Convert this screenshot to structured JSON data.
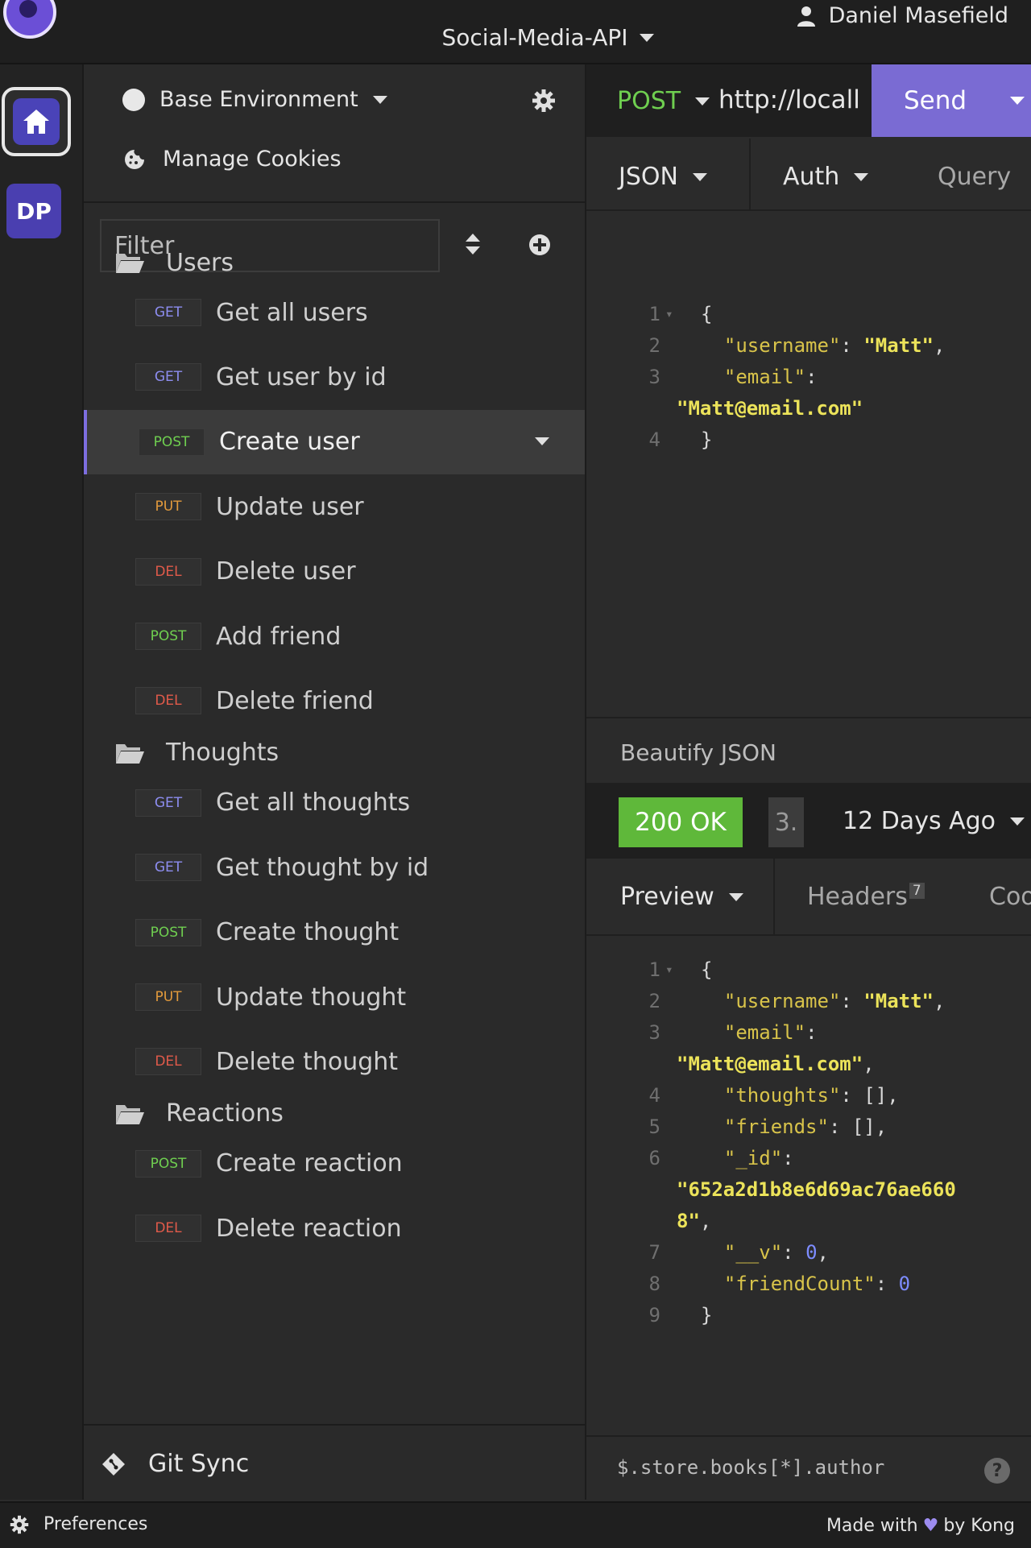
{
  "colors": {
    "accent": "#7a6bd3",
    "get": "#8d8df0",
    "post": "#6fcf50",
    "put": "#e29a3c",
    "del": "#e05a4a",
    "status_ok": "#5fb83a"
  },
  "topbar": {
    "project": "Social-Media-API",
    "user": "Daniel Masefield"
  },
  "rail": {
    "workspace_initials": "DP"
  },
  "sidebar": {
    "environment": "Base Environment",
    "manage_cookies": "Manage Cookies",
    "filter_placeholder": "Filter",
    "folders": [
      {
        "name": "Users",
        "requests": [
          {
            "method": "GET",
            "name": "Get all users"
          },
          {
            "method": "GET",
            "name": "Get user by id"
          },
          {
            "method": "POST",
            "name": "Create user"
          },
          {
            "method": "PUT",
            "name": "Update user"
          },
          {
            "method": "DEL",
            "name": "Delete user"
          },
          {
            "method": "POST",
            "name": "Add friend"
          },
          {
            "method": "DEL",
            "name": "Delete friend"
          }
        ]
      },
      {
        "name": "Thoughts",
        "requests": [
          {
            "method": "GET",
            "name": "Get all thoughts"
          },
          {
            "method": "GET",
            "name": "Get thought by id"
          },
          {
            "method": "POST",
            "name": "Create thought"
          },
          {
            "method": "PUT",
            "name": "Update thought"
          },
          {
            "method": "DEL",
            "name": "Delete thought"
          }
        ]
      },
      {
        "name": "Reactions",
        "requests": [
          {
            "method": "POST",
            "name": "Create reaction"
          },
          {
            "method": "DEL",
            "name": "Delete reaction"
          }
        ]
      }
    ],
    "git_sync": "Git Sync"
  },
  "request": {
    "method": "POST",
    "url": "http://locall",
    "send_label": "Send",
    "tabs": {
      "body": "JSON",
      "auth": "Auth",
      "query": "Query"
    },
    "beautify": "Beautify JSON"
  },
  "response": {
    "status": "200 OK",
    "time": "3.",
    "history": "12 Days Ago",
    "tabs": {
      "preview": "Preview",
      "headers": "Headers",
      "headers_count": "7",
      "cookies": "Coo"
    },
    "jsonpath_placeholder": "$.store.books[*].author",
    "help": "?"
  },
  "footer": {
    "preferences": "Preferences",
    "made_with": "Made with",
    "by": "by Kong"
  },
  "editors": {
    "request_body": [
      {
        "n": "1",
        "fold": true,
        "parts": [
          [
            "p",
            "{"
          ]
        ]
      },
      {
        "n": "2",
        "parts": [
          [
            "p",
            "  "
          ],
          [
            "k",
            "\"username\""
          ],
          [
            "p",
            ": "
          ],
          [
            "s",
            "\"Matt\""
          ],
          [
            "p",
            ","
          ]
        ]
      },
      {
        "n": "3",
        "parts": [
          [
            "p",
            "  "
          ],
          [
            "k",
            "\"email\""
          ],
          [
            "p",
            ":"
          ]
        ]
      },
      {
        "n": "",
        "parts": [
          [
            "s",
            "\"Matt@email.com\""
          ]
        ],
        "wrap": true
      },
      {
        "n": "4",
        "parts": [
          [
            "p",
            "}"
          ]
        ]
      }
    ],
    "response_body": [
      {
        "n": "1",
        "fold": true,
        "parts": [
          [
            "p",
            "{"
          ]
        ]
      },
      {
        "n": "2",
        "parts": [
          [
            "p",
            "  "
          ],
          [
            "k",
            "\"username\""
          ],
          [
            "p",
            ": "
          ],
          [
            "s",
            "\"Matt\""
          ],
          [
            "p",
            ","
          ]
        ]
      },
      {
        "n": "3",
        "parts": [
          [
            "p",
            "  "
          ],
          [
            "k",
            "\"email\""
          ],
          [
            "p",
            ":"
          ]
        ]
      },
      {
        "n": "",
        "parts": [
          [
            "s",
            "\"Matt@email.com\""
          ],
          [
            "p",
            ","
          ]
        ],
        "wrap": true
      },
      {
        "n": "4",
        "parts": [
          [
            "p",
            "  "
          ],
          [
            "k",
            "\"thoughts\""
          ],
          [
            "p",
            ": [],"
          ]
        ]
      },
      {
        "n": "5",
        "parts": [
          [
            "p",
            "  "
          ],
          [
            "k",
            "\"friends\""
          ],
          [
            "p",
            ": [],"
          ]
        ]
      },
      {
        "n": "6",
        "parts": [
          [
            "p",
            "  "
          ],
          [
            "k",
            "\"_id\""
          ],
          [
            "p",
            ":"
          ]
        ]
      },
      {
        "n": "",
        "parts": [
          [
            "s",
            "\"652a2d1b8e6d69ac76ae660"
          ]
        ],
        "wrap": true
      },
      {
        "n": "",
        "parts": [
          [
            "s",
            "8\""
          ],
          [
            "p",
            ","
          ]
        ],
        "wrap": true
      },
      {
        "n": "7",
        "parts": [
          [
            "p",
            "  "
          ],
          [
            "k",
            "\"__v\""
          ],
          [
            "p",
            ": "
          ],
          [
            "n",
            "0"
          ],
          [
            "p",
            ","
          ]
        ]
      },
      {
        "n": "8",
        "parts": [
          [
            "p",
            "  "
          ],
          [
            "k",
            "\"friendCount\""
          ],
          [
            "p",
            ": "
          ],
          [
            "n",
            "0"
          ]
        ]
      },
      {
        "n": "9",
        "parts": [
          [
            "p",
            "}"
          ]
        ]
      }
    ]
  }
}
